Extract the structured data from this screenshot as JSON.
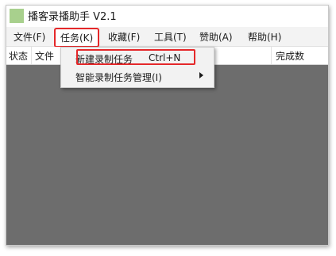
{
  "window": {
    "title": "播客录播助手 V2.1"
  },
  "menubar": {
    "items": [
      {
        "label": "文件(F)"
      },
      {
        "label": "任务(K)"
      },
      {
        "label": "收藏(F)"
      },
      {
        "label": "工具(T)"
      },
      {
        "label": "赞助(A)"
      },
      {
        "label": "帮助(H)"
      }
    ]
  },
  "table": {
    "columns": [
      "状态",
      "文件",
      "完成数"
    ]
  },
  "task_menu": {
    "items": [
      {
        "label": "新建录制任务",
        "shortcut": "Ctrl+N",
        "highlighted": true
      },
      {
        "label": "智能录制任务管理(I)",
        "has_submenu": true
      }
    ]
  },
  "colors": {
    "highlight": "#e5282a",
    "content_background": "#6d6d6d",
    "app_icon": "#a8d08d"
  }
}
